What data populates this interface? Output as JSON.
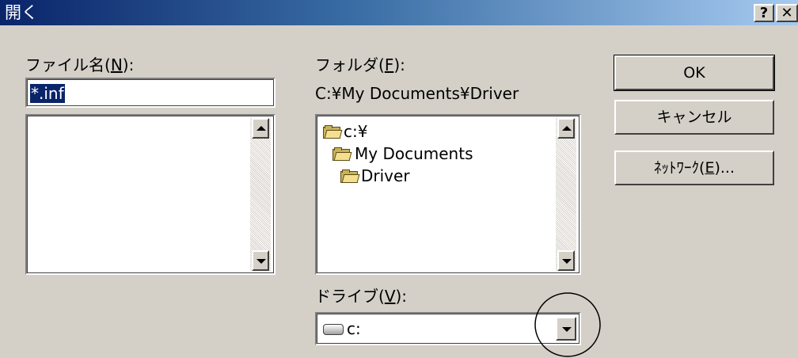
{
  "window": {
    "title": "開く",
    "help_label": "?",
    "close_label": "✕"
  },
  "file_name": {
    "label_prefix": "ファイル名(",
    "label_key": "N",
    "label_suffix": "):",
    "value": "*.inf"
  },
  "folders": {
    "label_prefix": "フォルダ(",
    "label_key": "F",
    "label_suffix": "):",
    "current_path": "C:¥My Documents¥Driver",
    "tree": [
      {
        "label": "c:¥",
        "icon": "open-folder-icon"
      },
      {
        "label": "My Documents",
        "icon": "open-folder-icon"
      },
      {
        "label": "Driver",
        "icon": "open-folder-icon"
      }
    ]
  },
  "drives": {
    "label_prefix": "ドライブ(",
    "label_key": "V",
    "label_suffix": "):",
    "selected": "c:",
    "icon": "drive-icon"
  },
  "buttons": {
    "ok": "OK",
    "cancel": "キャンセル",
    "network_prefix": "ﾈｯﾄﾜｰｸ(",
    "network_key": "E",
    "network_suffix": ")..."
  },
  "colors": {
    "title_gradient_start": "#0a246a",
    "title_gradient_end": "#a6caf0",
    "face": "#d4d0c8",
    "selection": "#0a246a"
  }
}
